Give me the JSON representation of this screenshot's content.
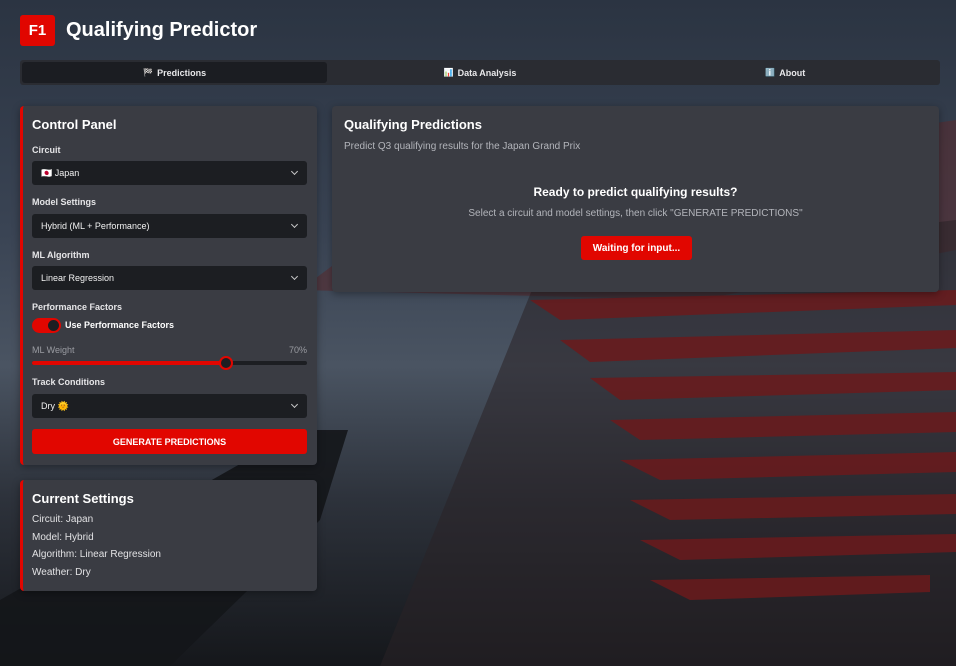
{
  "app": {
    "logo_text": "F1",
    "title": "Qualifying Predictor",
    "accent_color": "#e10600"
  },
  "tabs": [
    {
      "icon": "🏁",
      "label": "Predictions",
      "active": true
    },
    {
      "icon": "📊",
      "label": "Data Analysis",
      "active": false
    },
    {
      "icon": "ℹ️",
      "label": "About",
      "active": false
    }
  ],
  "control_panel": {
    "title": "Control Panel",
    "circuit_label": "Circuit",
    "circuit_value": "🇯🇵 Japan",
    "model_label": "Model Settings",
    "model_value": "Hybrid (ML + Performance)",
    "algorithm_label": "ML Algorithm",
    "algorithm_value": "Linear Regression",
    "performance_label": "Performance Factors",
    "toggle_label": "Use Performance Factors",
    "toggle_on": true,
    "weight_label": "ML Weight",
    "weight_value_text": "70%",
    "weight_fraction": 0.7,
    "track_label": "Track Conditions",
    "track_value": "Dry 🌞",
    "generate_label": "GENERATE PREDICTIONS"
  },
  "current_settings": {
    "title": "Current Settings",
    "circuit": "Circuit: Japan",
    "model": "Model: Hybrid",
    "algorithm": "Algorithm: Linear Regression",
    "weather": "Weather: Dry"
  },
  "predictions": {
    "title": "Qualifying Predictions",
    "subtitle": "Predict Q3 qualifying results for the Japan Grand Prix",
    "ready_title": "Ready to predict qualifying results?",
    "ready_subtitle": "Select a circuit and model settings, then click \"GENERATE PREDICTIONS\"",
    "waiting_label": "Waiting for input..."
  }
}
